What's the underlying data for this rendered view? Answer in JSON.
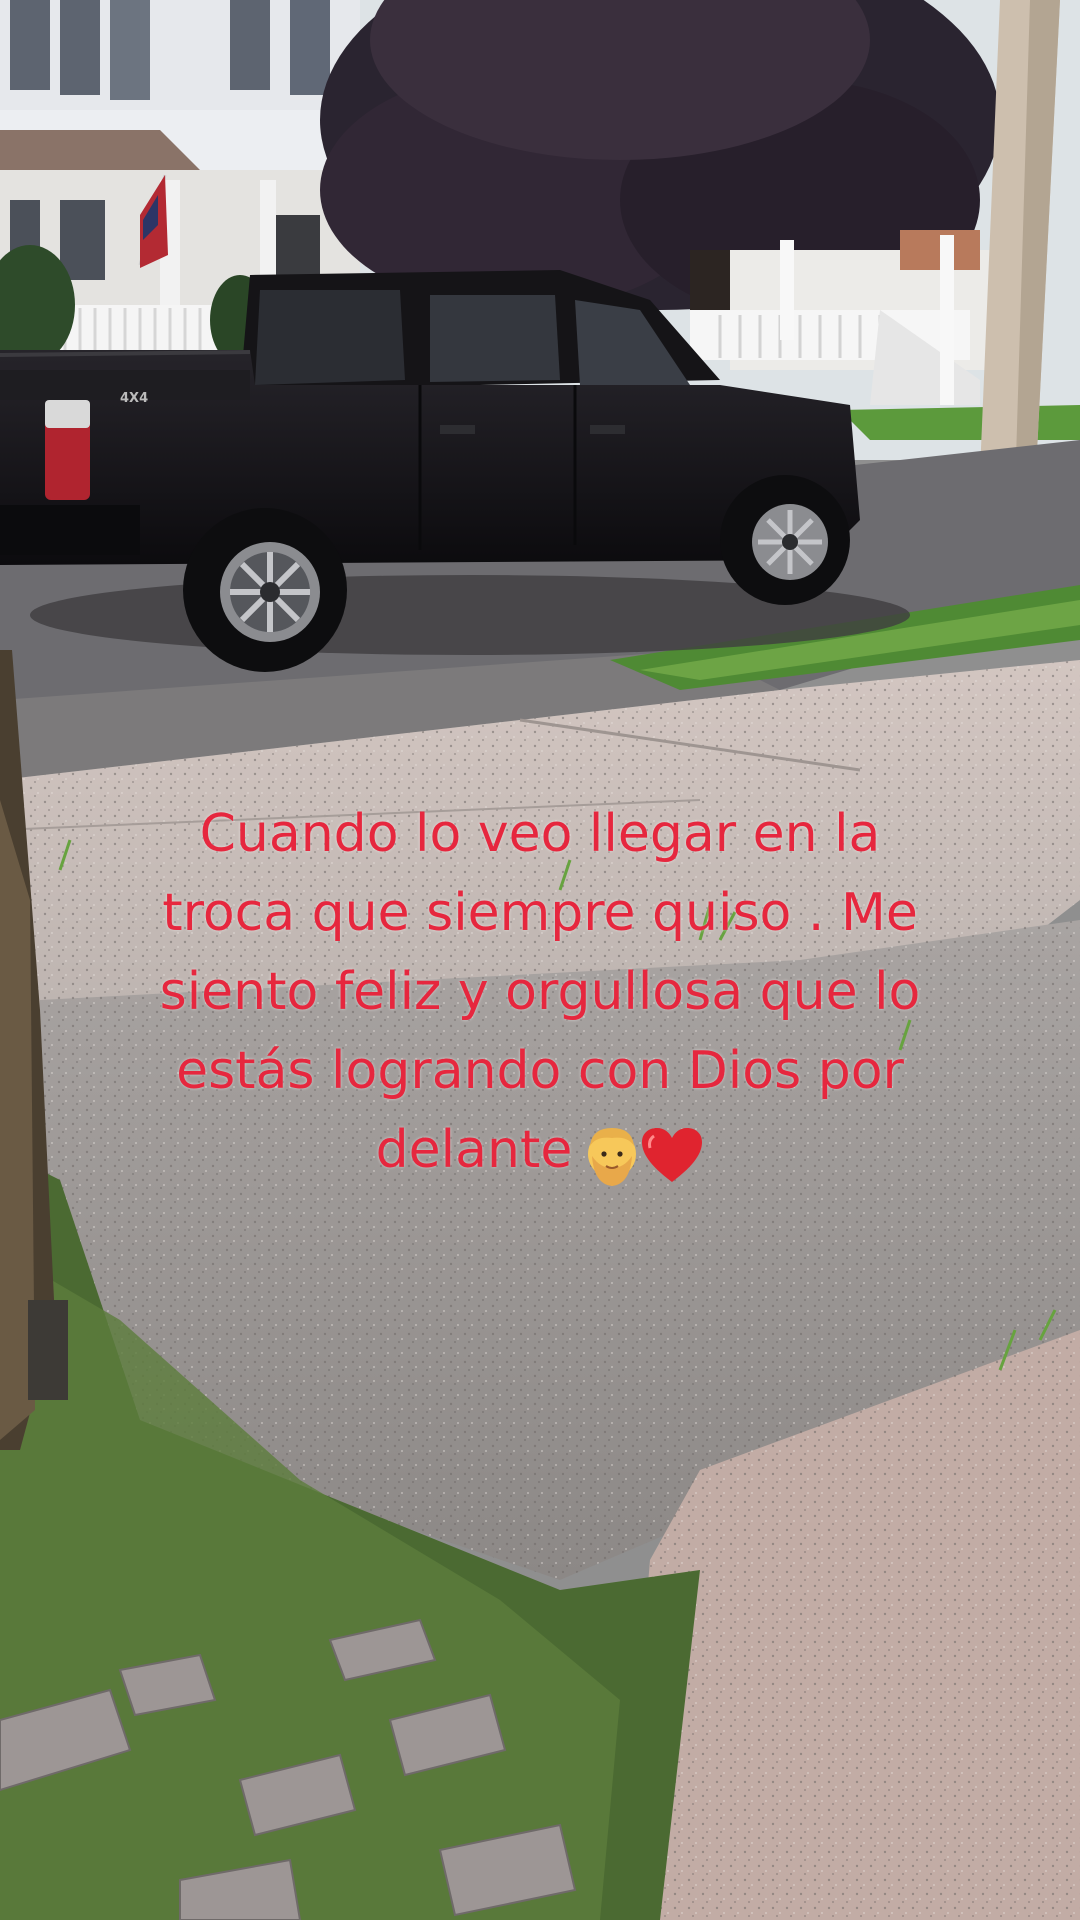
{
  "caption": {
    "text": "Cuando lo veo llegar en la\ntroca que siempre quiso . Me\nsiento feliz y orgullosa que lo\nestás logrando con Dios por\ndelante",
    "emojis": [
      "man-beard-emoji",
      "red-heart-emoji"
    ],
    "color": "#e6273e"
  },
  "scene": {
    "truck_badge": "4X4",
    "colors": {
      "sky": "#dfe6ea",
      "house": "#e9ebef",
      "tree": "#2c2430",
      "truck": "#141316",
      "road": "#6d6d6f",
      "grass": "#4f8a34",
      "sidewalk": "#c9bfbb",
      "pole": "#cfc3b1"
    }
  }
}
